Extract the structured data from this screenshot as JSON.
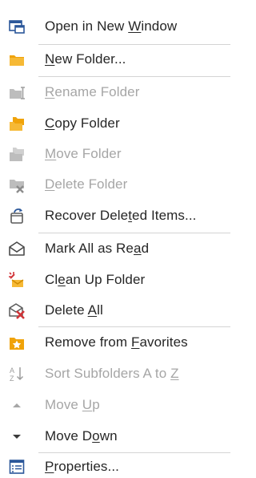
{
  "menu": {
    "items": [
      {
        "name": "open-in-new-window",
        "icon": "new-window-icon",
        "pre": "Open in New ",
        "key": "W",
        "post": "indow",
        "enabled": true
      },
      {
        "name": "new-folder",
        "icon": "new-folder-icon",
        "pre": "",
        "key": "N",
        "post": "ew Folder...",
        "enabled": true
      },
      {
        "name": "rename-folder",
        "icon": "rename-folder-icon",
        "pre": "",
        "key": "R",
        "post": "ename Folder",
        "enabled": false
      },
      {
        "name": "copy-folder",
        "icon": "copy-folder-icon",
        "pre": "",
        "key": "C",
        "post": "opy Folder",
        "enabled": true
      },
      {
        "name": "move-folder",
        "icon": "move-folder-icon",
        "pre": "",
        "key": "M",
        "post": "ove Folder",
        "enabled": false
      },
      {
        "name": "delete-folder",
        "icon": "delete-folder-icon",
        "pre": "",
        "key": "D",
        "post": "elete Folder",
        "enabled": false
      },
      {
        "name": "recover-deleted-items",
        "icon": "recover-items-icon",
        "pre": "Recover Dele",
        "key": "t",
        "post": "ed Items...",
        "enabled": true
      },
      {
        "name": "mark-all-as-read",
        "icon": "mark-read-envelope-icon",
        "pre": "Mark All as Re",
        "key": "a",
        "post": "d",
        "enabled": true
      },
      {
        "name": "clean-up-folder",
        "icon": "clean-up-icon",
        "pre": "Cl",
        "key": "e",
        "post": "an Up Folder",
        "enabled": true
      },
      {
        "name": "delete-all",
        "icon": "delete-all-icon",
        "pre": "Delete ",
        "key": "A",
        "post": "ll",
        "enabled": true
      },
      {
        "name": "remove-from-favorites",
        "icon": "favorite-star-folder-icon",
        "pre": "Remove from ",
        "key": "F",
        "post": "avorites",
        "enabled": true
      },
      {
        "name": "sort-subfolders",
        "icon": "sort-az-icon",
        "pre": "Sort Subfolders A to ",
        "key": "Z",
        "post": "",
        "enabled": false
      },
      {
        "name": "move-up",
        "icon": "triangle-up-icon",
        "pre": "Move ",
        "key": "U",
        "post": "p",
        "enabled": false
      },
      {
        "name": "move-down",
        "icon": "triangle-down-icon",
        "pre": "Move D",
        "key": "o",
        "post": "wn",
        "enabled": true
      },
      {
        "name": "properties",
        "icon": "properties-icon",
        "pre": "",
        "key": "P",
        "post": "roperties...",
        "enabled": true
      }
    ],
    "colors": {
      "text": "#262626",
      "disabled_text": "#a6a6a6",
      "separator": "#d4d4d4",
      "accent_blue": "#2b579a",
      "folder_orange": "#f0a30a",
      "delete_red": "#d13438"
    }
  }
}
